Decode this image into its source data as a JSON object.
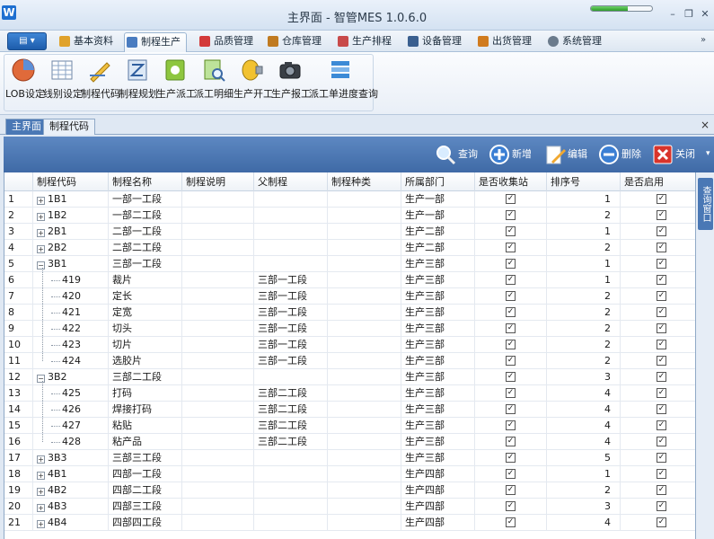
{
  "window": {
    "title": "主界面 - 智管MES 1.0.6.0",
    "logo": "W",
    "progress": 0.6,
    "minimize": "–",
    "restore": "❐",
    "close": "✕"
  },
  "menubar": {
    "app_button": "▤ ▾",
    "tabs": [
      {
        "label": "基本资料",
        "icon": "doc-folder-icon",
        "color": "#e0a22b"
      },
      {
        "label": "制程生产",
        "icon": "search-doc-icon",
        "color": "#4a7cc0",
        "active": true
      },
      {
        "label": "品质管理",
        "icon": "gem-icon",
        "color": "#d33a3a"
      },
      {
        "label": "仓库管理",
        "icon": "boxes-icon",
        "color": "#c07a20"
      },
      {
        "label": "生产排程",
        "icon": "calendar-icon",
        "color": "#c84a4a"
      },
      {
        "label": "设备管理",
        "icon": "device-icon",
        "color": "#3a5f8f"
      },
      {
        "label": "出货管理",
        "icon": "shipping-icon",
        "color": "#d07b1e"
      },
      {
        "label": "系统管理",
        "icon": "gear-icon",
        "color": "#6b7b8c"
      }
    ],
    "chevron": "»"
  },
  "ribbon": {
    "buttons": [
      {
        "label": "LOB设定",
        "icon": "pie-icon"
      },
      {
        "label": "线别设定",
        "icon": "grid-icon"
      },
      {
        "label": "制程代码",
        "icon": "pen-ruler-icon"
      },
      {
        "label": "制程规划",
        "icon": "route-icon"
      },
      {
        "label": "生产派工",
        "icon": "dispatch-icon"
      },
      {
        "label": "派工明细",
        "icon": "detail-search-icon"
      },
      {
        "label": "生产开工",
        "icon": "start-knob-icon"
      },
      {
        "label": "生产报工",
        "icon": "camera-report-icon"
      },
      {
        "label": "派工单进度查询",
        "icon": "progress-bars-icon"
      }
    ]
  },
  "doctabs": {
    "tabs": [
      {
        "label": "主界面",
        "active": true
      },
      {
        "label": "制程代码",
        "active": false
      }
    ],
    "close": "×"
  },
  "toolbar": {
    "query": "查询",
    "add": "新增",
    "edit": "编辑",
    "delete": "删除",
    "close": "关闭",
    "more": "▾"
  },
  "grid": {
    "columns": [
      "制程代码",
      "制程名称",
      "制程说明",
      "父制程",
      "制程种类",
      "所属部门",
      "是否收集站",
      "排序号",
      "是否启用"
    ],
    "rows": [
      {
        "n": "1",
        "code": "1B1",
        "name": "一部一工段",
        "parent": "",
        "dept": "生产一部",
        "collect": true,
        "sort": "1",
        "enabled": true,
        "level": 0,
        "exp": "+"
      },
      {
        "n": "2",
        "code": "1B2",
        "name": "一部二工段",
        "parent": "",
        "dept": "生产一部",
        "collect": true,
        "sort": "2",
        "enabled": true,
        "level": 0,
        "exp": "+"
      },
      {
        "n": "3",
        "code": "2B1",
        "name": "二部一工段",
        "parent": "",
        "dept": "生产二部",
        "collect": true,
        "sort": "1",
        "enabled": true,
        "level": 0,
        "exp": "+"
      },
      {
        "n": "4",
        "code": "2B2",
        "name": "二部二工段",
        "parent": "",
        "dept": "生产二部",
        "collect": true,
        "sort": "2",
        "enabled": true,
        "level": 0,
        "exp": "+"
      },
      {
        "n": "5",
        "code": "3B1",
        "name": "三部一工段",
        "parent": "",
        "dept": "生产三部",
        "collect": true,
        "sort": "1",
        "enabled": true,
        "level": 0,
        "exp": "−"
      },
      {
        "n": "6",
        "code": "419",
        "name": "裁片",
        "parent": "三部一工段",
        "dept": "生产三部",
        "collect": true,
        "sort": "1",
        "enabled": true,
        "level": 1
      },
      {
        "n": "7",
        "code": "420",
        "name": "定长",
        "parent": "三部一工段",
        "dept": "生产三部",
        "collect": true,
        "sort": "2",
        "enabled": true,
        "level": 1
      },
      {
        "n": "8",
        "code": "421",
        "name": "定宽",
        "parent": "三部一工段",
        "dept": "生产三部",
        "collect": true,
        "sort": "2",
        "enabled": true,
        "level": 1
      },
      {
        "n": "9",
        "code": "422",
        "name": "切头",
        "parent": "三部一工段",
        "dept": "生产三部",
        "collect": true,
        "sort": "2",
        "enabled": true,
        "level": 1
      },
      {
        "n": "10",
        "code": "423",
        "name": "切片",
        "parent": "三部一工段",
        "dept": "生产三部",
        "collect": true,
        "sort": "2",
        "enabled": true,
        "level": 1
      },
      {
        "n": "11",
        "code": "424",
        "name": "选胶片",
        "parent": "三部一工段",
        "dept": "生产三部",
        "collect": true,
        "sort": "2",
        "enabled": true,
        "level": 1
      },
      {
        "n": "12",
        "code": "3B2",
        "name": "三部二工段",
        "parent": "",
        "dept": "生产三部",
        "collect": true,
        "sort": "3",
        "enabled": true,
        "level": 0,
        "exp": "−"
      },
      {
        "n": "13",
        "code": "425",
        "name": "打码",
        "parent": "三部二工段",
        "dept": "生产三部",
        "collect": true,
        "sort": "4",
        "enabled": true,
        "level": 1
      },
      {
        "n": "14",
        "code": "426",
        "name": "焊接打码",
        "parent": "三部二工段",
        "dept": "生产三部",
        "collect": true,
        "sort": "4",
        "enabled": true,
        "level": 1
      },
      {
        "n": "15",
        "code": "427",
        "name": "粘贴",
        "parent": "三部二工段",
        "dept": "生产三部",
        "collect": true,
        "sort": "4",
        "enabled": true,
        "level": 1
      },
      {
        "n": "16",
        "code": "428",
        "name": "粘产品",
        "parent": "三部二工段",
        "dept": "生产三部",
        "collect": true,
        "sort": "4",
        "enabled": true,
        "level": 1
      },
      {
        "n": "17",
        "code": "3B3",
        "name": "三部三工段",
        "parent": "",
        "dept": "生产三部",
        "collect": true,
        "sort": "5",
        "enabled": true,
        "level": 0,
        "exp": "+"
      },
      {
        "n": "18",
        "code": "4B1",
        "name": "四部一工段",
        "parent": "",
        "dept": "生产四部",
        "collect": true,
        "sort": "1",
        "enabled": true,
        "level": 0,
        "exp": "+"
      },
      {
        "n": "19",
        "code": "4B2",
        "name": "四部二工段",
        "parent": "",
        "dept": "生产四部",
        "collect": true,
        "sort": "2",
        "enabled": true,
        "level": 0,
        "exp": "+"
      },
      {
        "n": "20",
        "code": "4B3",
        "name": "四部三工段",
        "parent": "",
        "dept": "生产四部",
        "collect": true,
        "sort": "3",
        "enabled": true,
        "level": 0,
        "exp": "+"
      },
      {
        "n": "21",
        "code": "4B4",
        "name": "四部四工段",
        "parent": "",
        "dept": "生产四部",
        "collect": true,
        "sort": "4",
        "enabled": true,
        "level": 0,
        "exp": "+"
      }
    ]
  },
  "side_panel": {
    "label": "查询窗口"
  }
}
